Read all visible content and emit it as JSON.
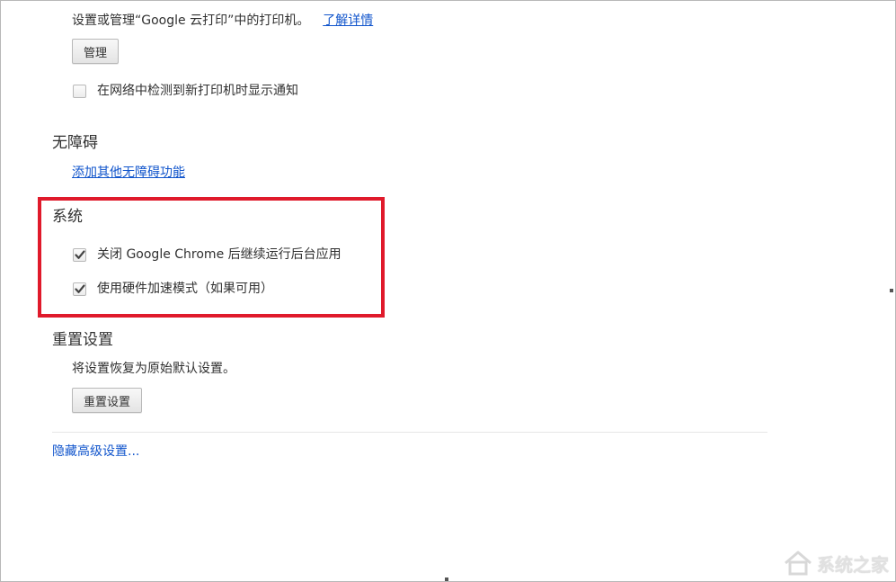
{
  "cloud_print": {
    "description": "设置或管理“Google 云打印”中的打印机。",
    "learn_more": "了解详情",
    "manage_button": "管理",
    "notify_new_printers": "在网络中检测到新打印机时显示通知",
    "notify_new_printers_checked": false
  },
  "accessibility": {
    "title": "无障碍",
    "add_features_link": "添加其他无障碍功能"
  },
  "system": {
    "title": "系统",
    "background_apps": "关闭 Google Chrome 后继续运行后台应用",
    "background_apps_checked": true,
    "hardware_accel": "使用硬件加速模式（如果可用）",
    "hardware_accel_checked": true
  },
  "reset": {
    "title": "重置设置",
    "description": "将设置恢复为原始默认设置。",
    "button": "重置设置"
  },
  "footer": {
    "hide_advanced": "隐藏高级设置..."
  },
  "watermark": {
    "text": "系统之家"
  },
  "colors": {
    "link": "#1155cc",
    "highlight": "#e01a2b",
    "text": "#303030"
  }
}
